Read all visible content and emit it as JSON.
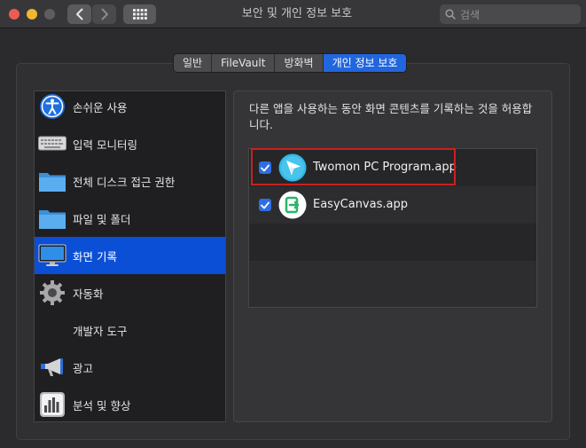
{
  "window": {
    "title": "보안 및 개인 정보 보호",
    "search_placeholder": "검색"
  },
  "tabs": [
    {
      "label": "일반",
      "active": false
    },
    {
      "label": "FileVault",
      "active": false
    },
    {
      "label": "방화벽",
      "active": false
    },
    {
      "label": "개인 정보 보호",
      "active": true
    }
  ],
  "sidebar": {
    "items": [
      {
        "label": "손쉬운 사용",
        "icon": "accessibility-icon",
        "selected": false
      },
      {
        "label": "입력 모니터링",
        "icon": "keyboard-icon",
        "selected": false
      },
      {
        "label": "전체 디스크 접근 권한",
        "icon": "folder-icon",
        "selected": false
      },
      {
        "label": "파일 및 폴더",
        "icon": "folder-icon",
        "selected": false
      },
      {
        "label": "화면 기록",
        "icon": "display-icon",
        "selected": true
      },
      {
        "label": "자동화",
        "icon": "gear-icon",
        "selected": false
      },
      {
        "label": "개발자 도구",
        "icon": "",
        "selected": false
      },
      {
        "label": "광고",
        "icon": "megaphone-icon",
        "selected": false
      },
      {
        "label": "분석 및 향상",
        "icon": "analytics-icon",
        "selected": false
      }
    ]
  },
  "panel": {
    "description": "다른 앱을 사용하는 동안 화면 콘텐츠를 기록하는 것을 허용합니다.",
    "apps": [
      {
        "name": "Twomon PC Program.app",
        "checked": true,
        "icon": "twomon-app-icon",
        "highlighted": true
      },
      {
        "name": "EasyCanvas.app",
        "checked": true,
        "icon": "easycanvas-app-icon",
        "highlighted": false
      }
    ]
  },
  "colors": {
    "accent": "#2266dd",
    "selection": "#0a4fd6",
    "highlight": "#cc1f1f"
  }
}
